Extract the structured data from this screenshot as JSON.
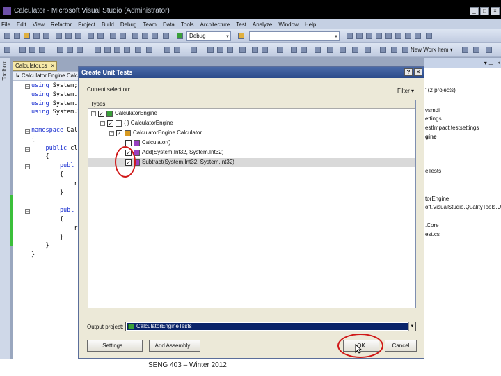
{
  "window": {
    "title": "Calculator - Microsoft Visual Studio (Administrator)",
    "controls": [
      "_",
      "□",
      "×"
    ]
  },
  "menu": [
    "File",
    "Edit",
    "View",
    "Refactor",
    "Project",
    "Build",
    "Debug",
    "Team",
    "Data",
    "Tools",
    "Architecture",
    "Test",
    "Analyze",
    "Window",
    "Help"
  ],
  "toolbar": {
    "config_combo": "Debug",
    "new_work_item": "New Work Item ▾"
  },
  "toolbox": {
    "label": "Toolbox"
  },
  "editor": {
    "tab_label": "Calculator.cs",
    "tab_close": "×",
    "breadcrumb": "↳ Calculator.Engine.Calcul",
    "code_lines": [
      {
        "kw": "using",
        "rest": " System;"
      },
      {
        "kw": "using",
        "rest": " System.C"
      },
      {
        "kw": "using",
        "rest": " System.L"
      },
      {
        "kw": "using",
        "rest": " System.T"
      },
      {
        "kw": "",
        "rest": ""
      },
      {
        "kw": "namespace",
        "rest": " Calc"
      },
      {
        "kw": "",
        "rest": "{"
      },
      {
        "kw": "    public",
        "rest": " cl"
      },
      {
        "kw": "",
        "rest": "    {"
      },
      {
        "kw": "        publ",
        "rest": ""
      },
      {
        "kw": "",
        "rest": "        {"
      },
      {
        "kw": "",
        "rest": "            re"
      },
      {
        "kw": "",
        "rest": "        }"
      },
      {
        "kw": "",
        "rest": ""
      },
      {
        "kw": "        publ",
        "rest": ""
      },
      {
        "kw": "",
        "rest": "        {"
      },
      {
        "kw": "",
        "rest": "            re"
      },
      {
        "kw": "",
        "rest": "        }"
      },
      {
        "kw": "",
        "rest": "    }"
      },
      {
        "kw": "",
        "rest": "}"
      }
    ]
  },
  "solution_explorer": {
    "pin": "▾ ⊥",
    "close": "×",
    "items": [
      "' (2 projects)",
      "vsmdi",
      "ettings",
      "estImpact.testsettings",
      "gine",
      "eTests",
      "torEngine",
      "oft.VisualStudio.QualityTools.Uni",
      ".Core",
      "est.cs"
    ]
  },
  "dialog": {
    "title": "Create Unit Tests",
    "help_btn": "?",
    "close_btn": "×",
    "current_selection_label": "Current selection:",
    "filter_label": "Filter ▾",
    "tree_header": "Types",
    "tree": [
      {
        "label": "CalculatorEngine",
        "level": 0,
        "expander": "−",
        "checked": true,
        "icon": "project-icon"
      },
      {
        "label": "{ } CalculatorEngine",
        "level": 1,
        "expander": "−",
        "checked": true,
        "icon": "namespace-icon"
      },
      {
        "label": "CalculatorEngine.Calculator",
        "level": 2,
        "expander": "−",
        "checked": true,
        "icon": "class-icon"
      },
      {
        "label": "Calculator()",
        "level": 3,
        "expander": "",
        "checked": false,
        "icon": "method-icon"
      },
      {
        "label": "Add(System.Int32, System.Int32)",
        "level": 3,
        "expander": "",
        "checked": true,
        "icon": "method-icon"
      },
      {
        "label": "Subtract(System.Int32, System.Int32)",
        "level": 3,
        "expander": "",
        "checked": true,
        "icon": "method-icon",
        "selected": true
      }
    ],
    "output_project_label": "Output project:",
    "output_project_value": "CalculatorEngineTests",
    "settings_button": "Settings...",
    "add_assembly_button": "Add Assembly...",
    "ok_button": "OK",
    "cancel_button": "Cancel"
  },
  "annotations": {
    "circle_color": "#d01818"
  },
  "footer": "SENG 403 – Winter 2012"
}
